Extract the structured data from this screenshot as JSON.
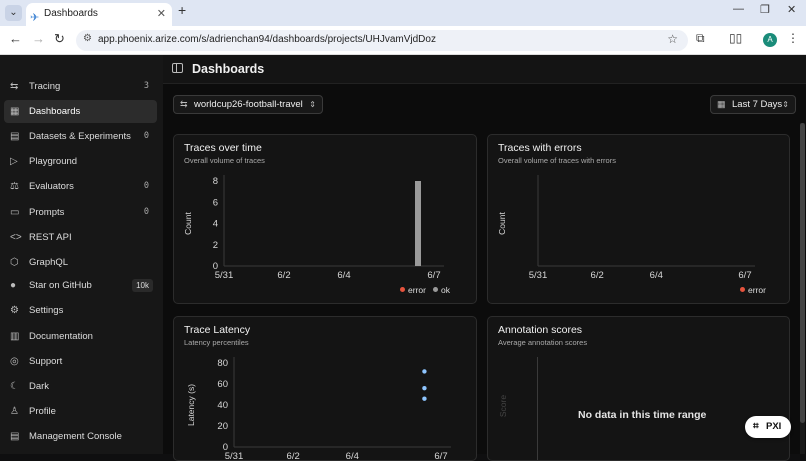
{
  "browser": {
    "tab_title": "Dashboards",
    "url": "app.phoenix.arize.com/s/adrienchan94/dashboards/projects/UHJvamVjdDoz",
    "avatar_letter": "A"
  },
  "sidebar": {
    "items": [
      {
        "label": "Tracing",
        "count": "3"
      },
      {
        "label": "Dashboards"
      },
      {
        "label": "Datasets & Experiments",
        "count": "0"
      },
      {
        "label": "Playground"
      },
      {
        "label": "Evaluators",
        "count": "0"
      },
      {
        "label": "Prompts",
        "count": "0"
      },
      {
        "label": "REST API"
      },
      {
        "label": "GraphQL"
      },
      {
        "label": "Star on GitHub",
        "badge": "10k"
      },
      {
        "label": "Settings"
      },
      {
        "label": "Documentation"
      },
      {
        "label": "Support"
      },
      {
        "label": "Dark"
      },
      {
        "label": "Profile"
      },
      {
        "label": "Management Console"
      }
    ]
  },
  "page": {
    "title": "Dashboards",
    "project": "worldcup26-football-travel",
    "date_range": "Last 7 Days"
  },
  "cards": {
    "traces": {
      "title": "Traces over time",
      "subtitle": "Overall volume of traces"
    },
    "errors": {
      "title": "Traces with errors",
      "subtitle": "Overall volume of traces with errors"
    },
    "latency": {
      "title": "Trace Latency",
      "subtitle": "Latency percentiles"
    },
    "annotations": {
      "title": "Annotation scores",
      "subtitle": "Average annotation scores",
      "empty_text": "No data in this time range",
      "ylabel": "Score"
    }
  },
  "colors": {
    "error": "#e5533d",
    "ok": "#9a9a9a",
    "latency_point": "#8ec5ff",
    "accent": "#4a8bd6"
  },
  "pxi_label": "PXI",
  "chart_data": [
    {
      "type": "bar",
      "title": "Traces over time",
      "ylabel": "Count",
      "ylim": [
        0,
        8
      ],
      "y_ticks": [
        0,
        2,
        4,
        6,
        8
      ],
      "x_ticks": [
        "5/31",
        "6/2",
        "6/4",
        "6/7"
      ],
      "series": [
        {
          "name": "error",
          "values": [
            0
          ]
        },
        {
          "name": "ok",
          "values": [
            8
          ]
        }
      ],
      "bar_date": "6/6",
      "legend": [
        "error",
        "ok"
      ]
    },
    {
      "type": "bar",
      "title": "Traces with errors",
      "ylabel": "Count",
      "x_ticks": [
        "5/31",
        "6/2",
        "6/4",
        "6/7"
      ],
      "series": [
        {
          "name": "error",
          "values": []
        }
      ],
      "legend": [
        "error"
      ]
    },
    {
      "type": "scatter",
      "title": "Trace Latency",
      "ylabel": "Latency (s)",
      "ylim": [
        0,
        80
      ],
      "y_ticks": [
        0,
        20,
        40,
        60,
        80
      ],
      "x_ticks": [
        "5/31",
        "6/2",
        "6/4",
        "6/7"
      ],
      "points": [
        {
          "x": "6/6",
          "y": 72
        },
        {
          "x": "6/6",
          "y": 56
        },
        {
          "x": "6/6",
          "y": 46
        }
      ]
    }
  ]
}
